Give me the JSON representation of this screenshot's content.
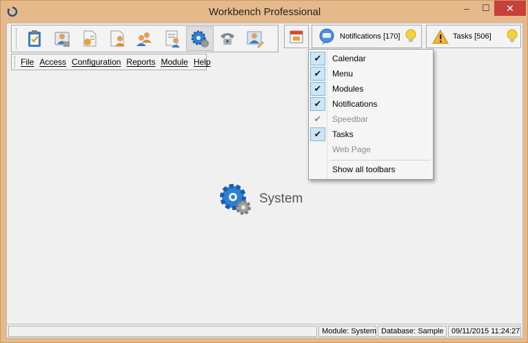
{
  "window": {
    "title": "Workbench Professional",
    "min_glyph": "‒",
    "max_glyph": "☐",
    "close_glyph": "✕"
  },
  "toolbar": {
    "icons": [
      "clipboard-icon",
      "user-card-icon",
      "document-user-icon",
      "user-document-icon",
      "users-group-icon",
      "user-list-icon",
      "gear-icon",
      "phone-icon",
      "user-edit-icon"
    ],
    "active_index": 6
  },
  "notifications": {
    "label": "Notifications [170]"
  },
  "tasks": {
    "label": "Tasks [506]"
  },
  "menu": {
    "items": [
      "File",
      "Access",
      "Configuration",
      "Reports",
      "Module",
      "Help"
    ]
  },
  "center": {
    "label": "System"
  },
  "status": {
    "module": "Module: System",
    "database": "Database: Sample",
    "datetime": "09/11/2015 11:24:27"
  },
  "dropdown": {
    "items": [
      {
        "label": "Calendar",
        "checked": true,
        "enabled": true
      },
      {
        "label": "Menu",
        "checked": true,
        "enabled": true
      },
      {
        "label": "Modules",
        "checked": true,
        "enabled": true
      },
      {
        "label": "Notifications",
        "checked": true,
        "enabled": true
      },
      {
        "label": "Speedbar",
        "checked": true,
        "enabled": false
      },
      {
        "label": "Tasks",
        "checked": true,
        "enabled": true
      },
      {
        "label": "Web Page",
        "checked": false,
        "enabled": false
      }
    ],
    "show_all": "Show all toolbars"
  },
  "colors": {
    "title_bg": "#e6b98a",
    "close_red": "#c7413a",
    "check_bg": "#cde6f7",
    "icon_blue": "#2f7fd0"
  }
}
